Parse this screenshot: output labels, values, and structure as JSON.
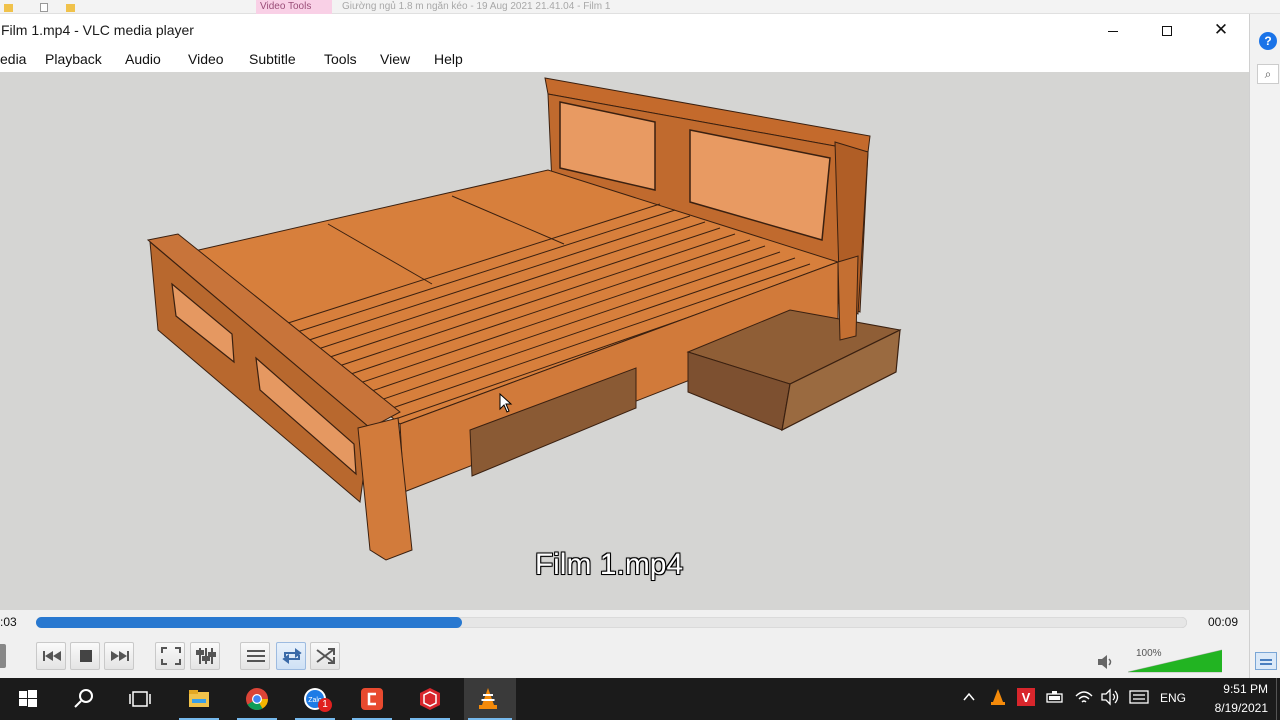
{
  "background_window": {
    "ribbon_tab": "Video Tools",
    "ribbon_text": "Giường ngủ 1.8 m ngăn kéo - 19 Aug 2021 21.41.04 - Film 1"
  },
  "window": {
    "title": "Film 1.mp4 - VLC media player",
    "minimize_label": "",
    "close_glyph": "✕"
  },
  "menu": {
    "items": [
      "edia",
      "Playback",
      "Audio",
      "Video",
      "Subtitle",
      "Tools",
      "View",
      "Help"
    ]
  },
  "video": {
    "subtitle": "Film 1.mp4"
  },
  "playback": {
    "elapsed": ":03",
    "total": "00:09",
    "progress_fraction": 0.37
  },
  "controls": {
    "buttons": [
      "previous",
      "stop",
      "next",
      "fullscreen",
      "extended-settings",
      "playlist",
      "loop",
      "shuffle"
    ],
    "loop_active": true
  },
  "volume": {
    "percent_label": "100%",
    "level_fraction": 1.0
  },
  "taskbar": {
    "apps": [
      "start",
      "search",
      "task-view",
      "file-explorer",
      "chrome",
      "zalo",
      "app-red",
      "sketchup",
      "vlc"
    ],
    "zalo_badge": "1",
    "language": "ENG",
    "time": "9:51 PM",
    "date": "8/19/2021"
  },
  "colors": {
    "seek_fill": "#2878d0",
    "volume_fill": "#22b422",
    "taskbar": "#1b1b1b",
    "video_bg": "#d5d5d3"
  }
}
